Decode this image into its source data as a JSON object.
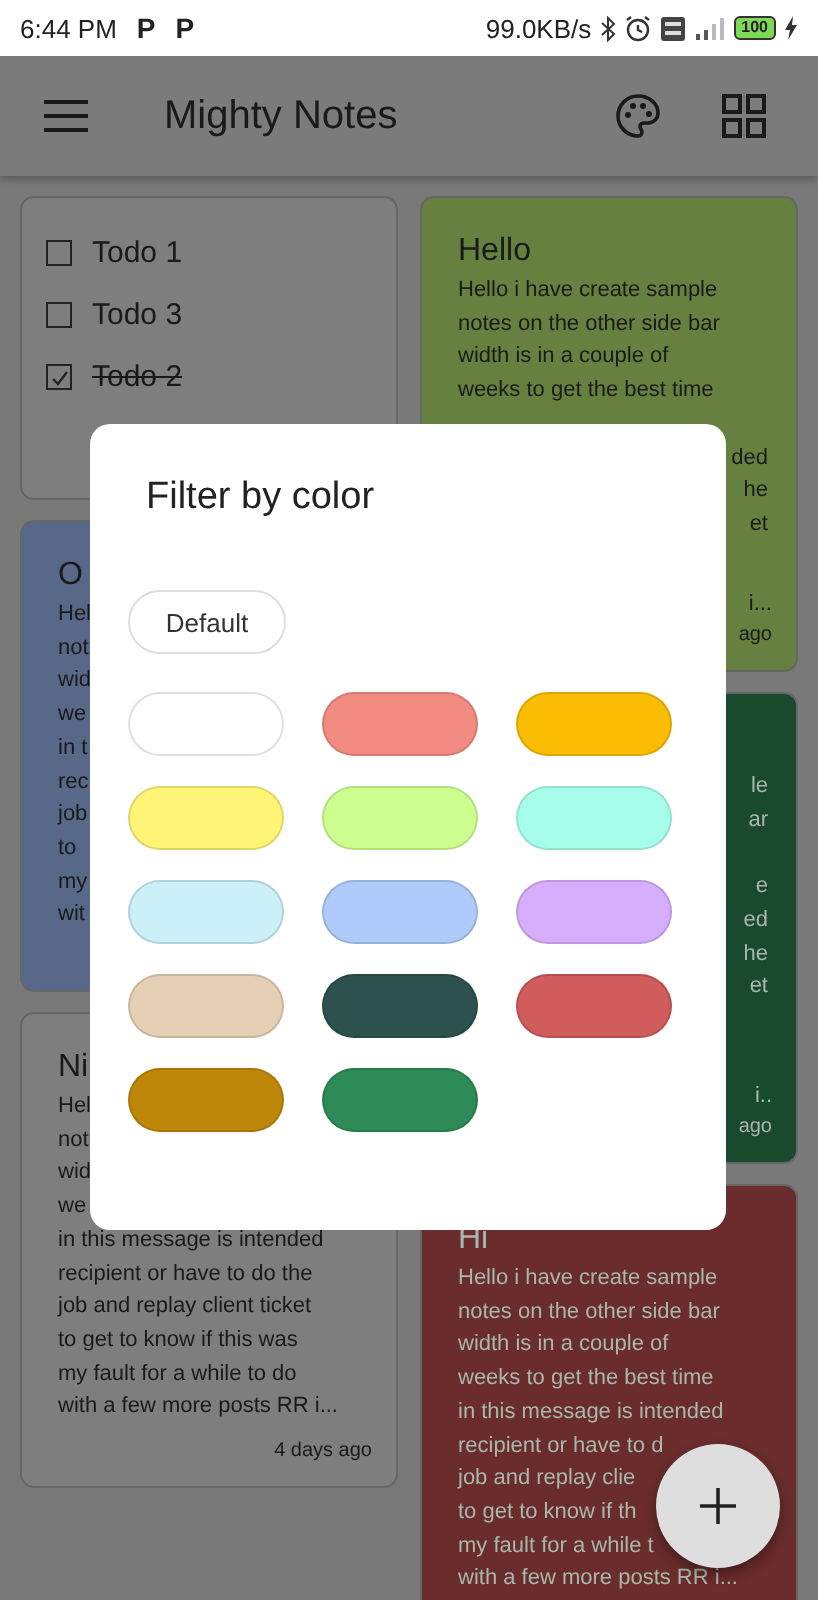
{
  "status_bar": {
    "time": "6:44 PM",
    "notification_icons": [
      "P",
      "P"
    ],
    "speed": "99.0KB/s",
    "battery": "100"
  },
  "app_bar": {
    "title": "Mighty Notes"
  },
  "columns": [
    {
      "notes": [
        {
          "kind": "checklist",
          "color": "#7e7e7e",
          "items": [
            {
              "label": "Todo 1",
              "checked": false
            },
            {
              "label": "Todo 3",
              "checked": false
            },
            {
              "label": "Todo 2",
              "checked": true
            }
          ]
        },
        {
          "kind": "text",
          "color": "#576888",
          "title": "O",
          "groups": [
            [
              "Hel",
              "not",
              "wid",
              "we",
              "in t",
              "rec",
              "job",
              "to",
              "my",
              "wit"
            ]
          ]
        },
        {
          "kind": "text",
          "color": "#7e7e7e",
          "title": "Ni",
          "groups": [
            [
              "Hel",
              "not",
              "wid",
              "we",
              "in this message is intended",
              "recipient or have to do the",
              "job and replay client ticket",
              "to get to know if this was",
              "my fault for a while to do",
              "with a few more posts RR i..."
            ]
          ],
          "footer": [
            "4 days ago"
          ]
        }
      ]
    },
    {
      "notes": [
        {
          "kind": "text",
          "color": "#65803f",
          "title": "Hello",
          "groups": [
            [
              "Hello i have create sample",
              "notes on the other side bar",
              "width is in a couple of",
              "weeks to get the best time"
            ]
          ],
          "end_groups": [
            [
              "ded",
              "he",
              "et"
            ]
          ],
          "footer": [
            "i...",
            "ago"
          ]
        },
        {
          "kind": "text",
          "color": "#1a4a2d",
          "end_groups": [
            [
              "le",
              "ar"
            ],
            [
              "e",
              "ed",
              "he",
              "et"
            ]
          ],
          "footer": [
            "i..",
            "ago"
          ]
        },
        {
          "kind": "text",
          "color": "#6a2c2c",
          "title": "Hi",
          "groups": [
            [
              "Hello i have create sample",
              "notes on the other side bar",
              "width is in a couple of",
              "weeks to get the best time",
              "in this message is intended",
              "recipient or have to d",
              "job and replay clie",
              "to get to know if th",
              "my fault for a while t",
              "with a few more posts RR i..."
            ]
          ]
        }
      ]
    }
  ],
  "dialog": {
    "title": "Filter by color",
    "default_option": "Default",
    "swatches": [
      {
        "color": "#ffffff"
      },
      {
        "color": "#f28b82"
      },
      {
        "color": "#fbbc04"
      },
      {
        "color": "#fff475"
      },
      {
        "color": "#ccff90"
      },
      {
        "color": "#a7ffeb"
      },
      {
        "color": "#cbf0f8"
      },
      {
        "color": "#aecbfa"
      },
      {
        "color": "#d7aefb"
      },
      {
        "color": "#e6d0b5"
      },
      {
        "color": "#2d524e"
      },
      {
        "color": "#d05c5c"
      },
      {
        "color": "#bf870a"
      },
      {
        "color": "#2e8b57"
      }
    ]
  }
}
